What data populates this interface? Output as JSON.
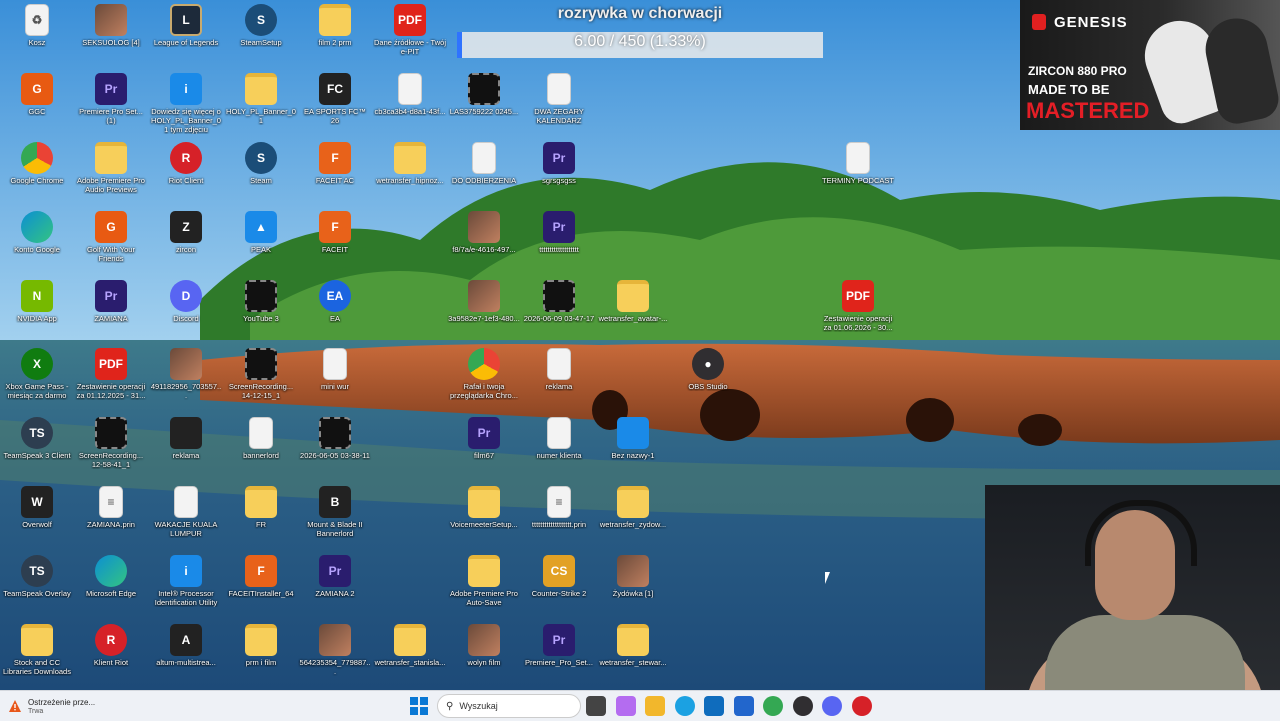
{
  "overlay": {
    "title": "rozrywka w chorwacji",
    "progress_text": "6.00 / 450 (1.33%)",
    "progress_fraction": 0.0133
  },
  "ad": {
    "brand": "GENESIS",
    "model": "ZIRCON 880 PRO",
    "tagline": "MADE TO BE",
    "emphasis": "MASTERED"
  },
  "desktop_icons": [
    {
      "label": "Kosz",
      "icon": "recycle-bin-icon",
      "kind": "file",
      "glyph": "♻"
    },
    {
      "label": "SEKSUOLOG [4]",
      "icon": "video-thumbnail-icon",
      "kind": "img",
      "glyph": ""
    },
    {
      "label": "League of Legends",
      "icon": "league-of-legends-icon",
      "kind": "lol",
      "glyph": "L"
    },
    {
      "label": "SteamSetup",
      "icon": "steam-icon",
      "kind": "steam",
      "glyph": "S"
    },
    {
      "label": "film 2 prm",
      "icon": "clapperboard-icon",
      "kind": "folder",
      "glyph": ""
    },
    {
      "label": "Dane źródłowe - Twój e-PIT",
      "icon": "pdf-icon",
      "kind": "pdf",
      "glyph": "PDF"
    },
    {
      "label": "GGC",
      "icon": "gog-galaxy-icon",
      "kind": "gog",
      "glyph": "G"
    },
    {
      "label": "Premiere Pro Set... (1)",
      "icon": "premiere-pro-icon",
      "kind": "pr",
      "glyph": "Pr"
    },
    {
      "label": "Dowiedz się więcej o HOLY_PL_Banner_01 tym zdjęciu",
      "icon": "info-icon",
      "kind": "info",
      "glyph": "i"
    },
    {
      "label": "HOLY_PL_Banner_01",
      "icon": "folder-icon",
      "kind": "folder",
      "glyph": ""
    },
    {
      "label": "EA SPORTS FC™ 26",
      "icon": "ea-fc-icon",
      "kind": "dark",
      "glyph": "FC"
    },
    {
      "label": "cb3ca3b4-d8a1-43f...",
      "icon": "image-file-icon",
      "kind": "file",
      "glyph": ""
    },
    {
      "label": "LAS3759222 0245...",
      "icon": "video-file-icon",
      "kind": "vid",
      "glyph": ""
    },
    {
      "label": "DWA ZEGARY KALENDARZ",
      "icon": "document-icon",
      "kind": "file",
      "glyph": ""
    },
    {
      "label": "Google Chrome",
      "icon": "chrome-icon",
      "kind": "chrome",
      "glyph": ""
    },
    {
      "label": "Adobe Premiere Pro Audio Previews",
      "icon": "folder-icon",
      "kind": "folder",
      "glyph": ""
    },
    {
      "label": "Riot Client",
      "icon": "riot-icon",
      "kind": "riot",
      "glyph": "R"
    },
    {
      "label": "Steam",
      "icon": "steam-icon",
      "kind": "steam",
      "glyph": "S"
    },
    {
      "label": "FACEIT AC",
      "icon": "faceit-ac-icon",
      "kind": "faceit",
      "glyph": "F"
    },
    {
      "label": "wetransfer_hipnoz...",
      "icon": "folder-icon",
      "kind": "folder",
      "glyph": ""
    },
    {
      "label": "DO ODBIERZENIA",
      "icon": "document-icon",
      "kind": "file",
      "glyph": ""
    },
    {
      "label": "sgrsgsgss",
      "icon": "premiere-project-icon",
      "kind": "pr",
      "glyph": "Pr"
    },
    {
      "label": "TERMINY PODCAST",
      "icon": "document-icon",
      "kind": "file",
      "glyph": ""
    },
    {
      "label": "Konto Google",
      "icon": "edge-icon",
      "kind": "edge",
      "glyph": ""
    },
    {
      "label": "Golf With Your Friends",
      "icon": "golf-game-icon",
      "kind": "gog",
      "glyph": "G"
    },
    {
      "label": "zircon",
      "icon": "zircon-mouse-icon",
      "kind": "dark",
      "glyph": "Z"
    },
    {
      "label": "PEAK",
      "icon": "peak-game-icon",
      "kind": "info",
      "glyph": "▲"
    },
    {
      "label": "FACEIT",
      "icon": "faceit-icon",
      "kind": "faceit",
      "glyph": "F"
    },
    {
      "label": "f8/7a/e-4616-497...",
      "icon": "image-file-icon",
      "kind": "img",
      "glyph": ""
    },
    {
      "label": "ttttttttttttttttttt",
      "icon": "premiere-project-icon",
      "kind": "pr",
      "glyph": "Pr"
    },
    {
      "label": "NVIDIA App",
      "icon": "nvidia-icon",
      "kind": "nv",
      "glyph": "N"
    },
    {
      "label": "ZAMIANA",
      "icon": "premiere-project-icon",
      "kind": "pr",
      "glyph": "Pr"
    },
    {
      "label": "Discord",
      "icon": "discord-icon",
      "kind": "discord",
      "glyph": "D"
    },
    {
      "label": "YouTube 3",
      "icon": "video-file-icon",
      "kind": "vid",
      "glyph": ""
    },
    {
      "label": "EA",
      "icon": "ea-icon",
      "kind": "ea",
      "glyph": "EA"
    },
    {
      "label": "3a9582e7-1ef3-480...",
      "icon": "image-file-icon",
      "kind": "img",
      "glyph": ""
    },
    {
      "label": "2026-06-09 03-47-17",
      "icon": "video-file-icon",
      "kind": "vid",
      "glyph": ""
    },
    {
      "label": "wetransfer_avatar-...",
      "icon": "folder-icon",
      "kind": "folder",
      "glyph": ""
    },
    {
      "label": "Zestawienie operacji za 01.06.2026 - 30...",
      "icon": "pdf-icon",
      "kind": "pdf",
      "glyph": "PDF"
    },
    {
      "label": "Xbox Game Pass - miesiąc za darmo",
      "icon": "xbox-icon",
      "kind": "xbox",
      "glyph": "X"
    },
    {
      "label": "Zestawienie operacji za 01.12.2025 - 31...",
      "icon": "pdf-icon",
      "kind": "pdf",
      "glyph": "PDF"
    },
    {
      "label": "491182956_703557...",
      "icon": "image-file-icon",
      "kind": "img",
      "glyph": ""
    },
    {
      "label": "ScreenRecording... 14-12-15_1",
      "icon": "video-file-icon",
      "kind": "vid",
      "glyph": ""
    },
    {
      "label": "mini wur",
      "icon": "document-icon",
      "kind": "file",
      "glyph": ""
    },
    {
      "label": "Rafał i twoja przeglądarka Chro...",
      "icon": "chrome-profile-icon",
      "kind": "chrome",
      "glyph": ""
    },
    {
      "label": "reklama",
      "icon": "document-icon",
      "kind": "file",
      "glyph": ""
    },
    {
      "label": "OBS Studio",
      "icon": "obs-icon",
      "kind": "obs",
      "glyph": "●"
    },
    {
      "label": "TeamSpeak 3 Client",
      "icon": "teamspeak-icon",
      "kind": "ts",
      "glyph": "TS"
    },
    {
      "label": "ScreenRecording... 12-58-41_1",
      "icon": "video-file-icon",
      "kind": "vid",
      "glyph": ""
    },
    {
      "label": "reklama",
      "icon": "video-file-icon",
      "kind": "dark",
      "glyph": ""
    },
    {
      "label": "bannerlord",
      "icon": "document-icon",
      "kind": "file",
      "glyph": ""
    },
    {
      "label": "2026-06-05 03-38-11",
      "icon": "video-file-icon",
      "kind": "vid",
      "glyph": ""
    },
    {
      "label": "film67",
      "icon": "premiere-project-icon",
      "kind": "pr",
      "glyph": "Pr"
    },
    {
      "label": "numer klienta",
      "icon": "document-icon",
      "kind": "file",
      "glyph": ""
    },
    {
      "label": "Bez nazwy-1",
      "icon": "image-file-icon",
      "kind": "info",
      "glyph": ""
    },
    {
      "label": "Overwolf",
      "icon": "overwolf-icon",
      "kind": "dark",
      "glyph": "W"
    },
    {
      "label": "ZAMIANA.prin",
      "icon": "document-icon",
      "kind": "file",
      "glyph": "≡"
    },
    {
      "label": "WAKACJE KUALA LUMPUR",
      "icon": "document-icon",
      "kind": "file",
      "glyph": ""
    },
    {
      "label": "FR",
      "icon": "folder-icon",
      "kind": "folder",
      "glyph": ""
    },
    {
      "label": "Mount & Blade II Bannerlord",
      "icon": "bannerlord-icon",
      "kind": "dark",
      "glyph": "B"
    },
    {
      "label": "VoicemeeterSetup...",
      "icon": "folder-icon",
      "kind": "folder",
      "glyph": ""
    },
    {
      "label": "ttttttttttttttttttt.prin",
      "icon": "document-icon",
      "kind": "file",
      "glyph": "≡"
    },
    {
      "label": "wetransfer_zydow...",
      "icon": "folder-icon",
      "kind": "folder",
      "glyph": ""
    },
    {
      "label": "TeamSpeak Overlay",
      "icon": "teamspeak-icon",
      "kind": "ts",
      "glyph": "TS"
    },
    {
      "label": "Microsoft Edge",
      "icon": "edge-icon",
      "kind": "edge",
      "glyph": ""
    },
    {
      "label": "Intel® Processor Identification Utility",
      "icon": "intel-icon",
      "kind": "info",
      "glyph": "i"
    },
    {
      "label": "FACEITInstaller_64",
      "icon": "faceit-icon",
      "kind": "faceit",
      "glyph": "F"
    },
    {
      "label": "ZAMIANA 2",
      "icon": "premiere-project-icon",
      "kind": "pr",
      "glyph": "Pr"
    },
    {
      "label": "Adobe Premiere Pro Auto-Save",
      "icon": "folder-icon",
      "kind": "folder",
      "glyph": ""
    },
    {
      "label": "Counter-Strike 2",
      "icon": "counter-strike-icon",
      "kind": "cs",
      "glyph": "CS"
    },
    {
      "label": "Żydówka [1]",
      "icon": "image-file-icon",
      "kind": "img",
      "glyph": ""
    },
    {
      "label": "Stock and CC Libraries Downloads",
      "icon": "folder-icon",
      "kind": "folder",
      "glyph": ""
    },
    {
      "label": "Klient Riot",
      "icon": "riot-icon",
      "kind": "riot",
      "glyph": "R"
    },
    {
      "label": "altum-multistrea...",
      "icon": "altum-icon",
      "kind": "dark",
      "glyph": "A"
    },
    {
      "label": "prm i film",
      "icon": "folder-icon",
      "kind": "folder",
      "glyph": ""
    },
    {
      "label": "564235354_779887...",
      "icon": "image-file-icon",
      "kind": "img",
      "glyph": ""
    },
    {
      "label": "wetransfer_stanisla...",
      "icon": "folder-icon",
      "kind": "folder",
      "glyph": ""
    },
    {
      "label": "wolyn film",
      "icon": "video-file-icon",
      "kind": "img",
      "glyph": ""
    },
    {
      "label": "Premiere_Pro_Set...",
      "icon": "premiere-pro-icon",
      "kind": "pr",
      "glyph": "Pr"
    },
    {
      "label": "wetransfer_stewar...",
      "icon": "folder-icon",
      "kind": "folder",
      "glyph": ""
    }
  ],
  "taskbar": {
    "notification_title": "Ostrzeżenie prze...",
    "notification_sub": "Trwa",
    "search_placeholder": "Wyszukaj",
    "apps": [
      {
        "icon": "task-view-icon",
        "color": "#444444"
      },
      {
        "icon": "copilot-icon",
        "color": "#b46cf0"
      },
      {
        "icon": "file-explorer-icon",
        "color": "#f2b72c"
      },
      {
        "icon": "edge-icon",
        "color": "#1ba1e2"
      },
      {
        "icon": "outlook-icon",
        "color": "#0f6cbd"
      },
      {
        "icon": "microsoft-store-icon",
        "color": "#2266cc"
      },
      {
        "icon": "chrome-icon",
        "color": "#34a853"
      },
      {
        "icon": "obs-icon",
        "color": "#302e31"
      },
      {
        "icon": "discord-icon",
        "color": "#5865f2"
      },
      {
        "icon": "riot-icon",
        "color": "#d62128"
      }
    ]
  }
}
